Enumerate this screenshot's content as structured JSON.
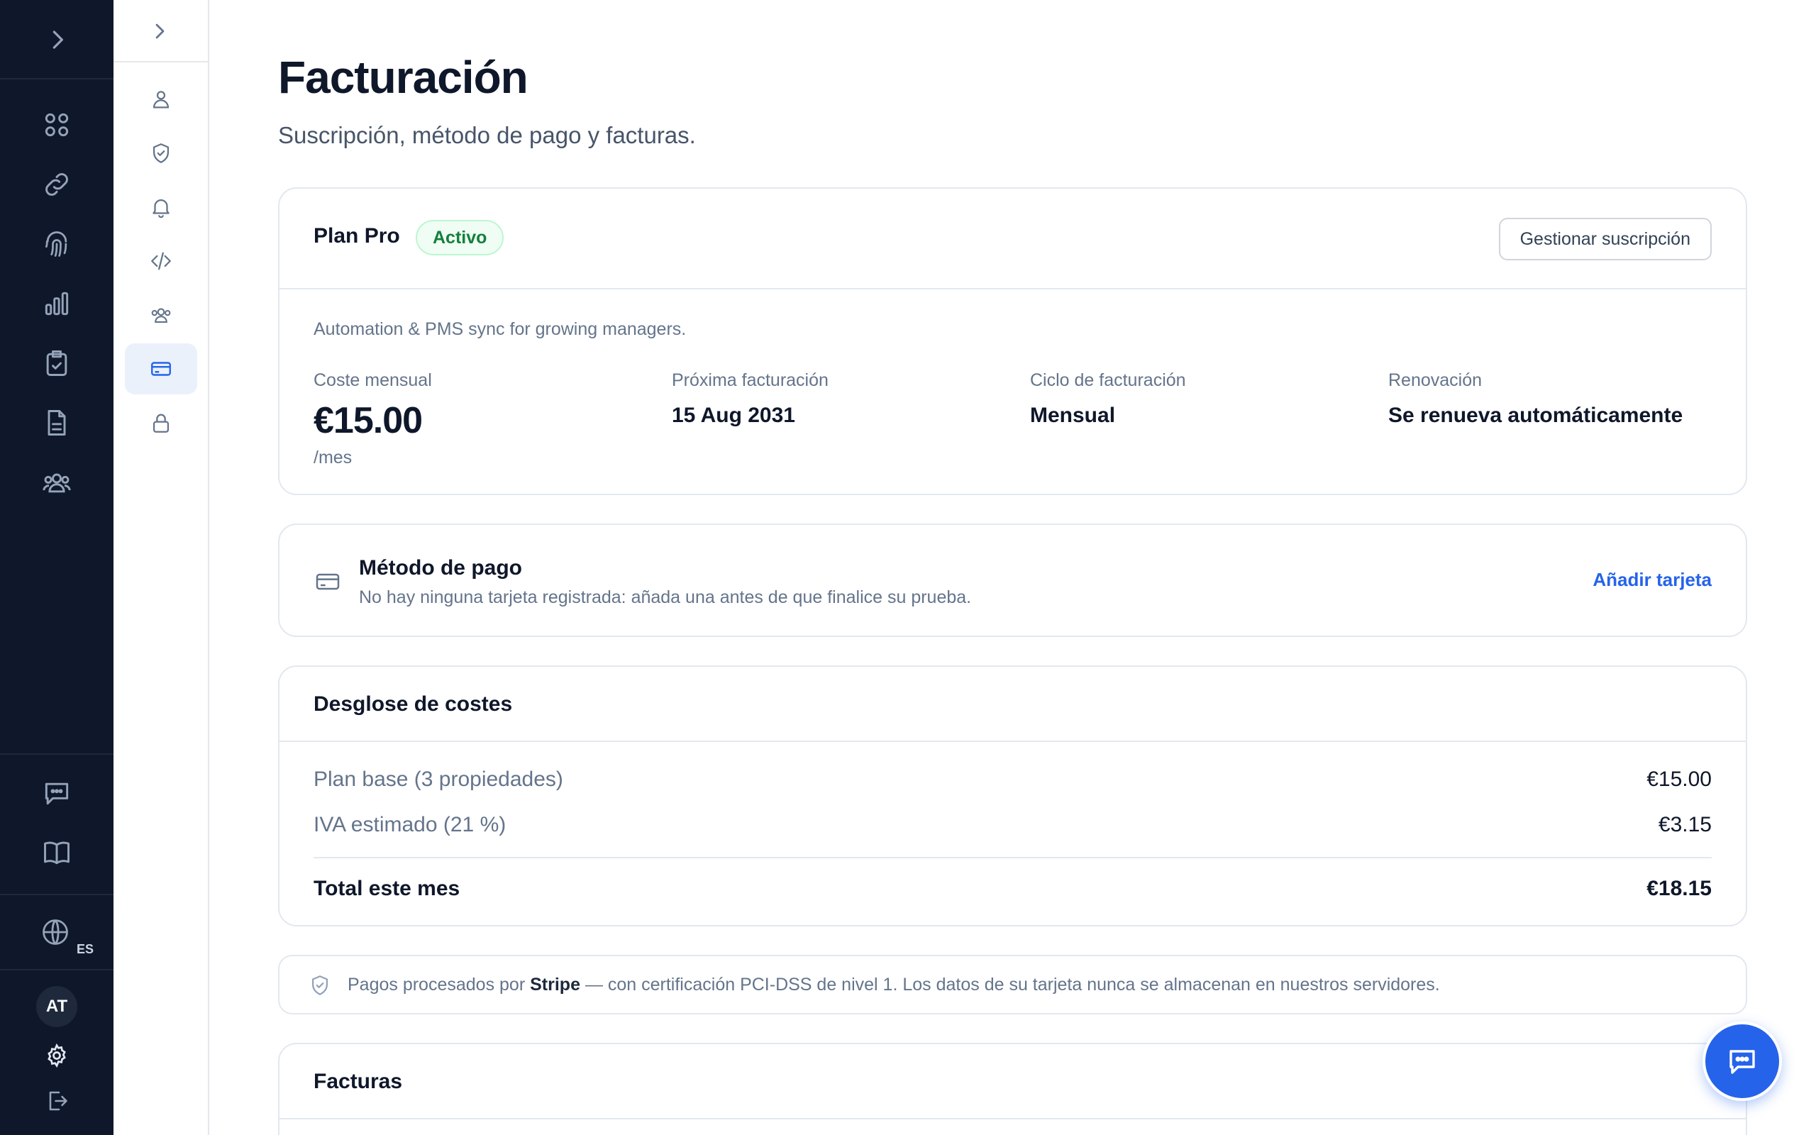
{
  "language": {
    "code": "ES"
  },
  "user": {
    "initials": "AT"
  },
  "page": {
    "title": "Facturación",
    "subtitle": "Suscripción, método de pago y facturas."
  },
  "plan": {
    "name": "Plan Pro",
    "status": "Activo",
    "manage_label": "Gestionar suscripción",
    "description": "Automation & PMS sync for growing managers.",
    "monthly_cost_label": "Coste mensual",
    "monthly_cost": "€15.00",
    "per_unit": "/mes",
    "next_billing_label": "Próxima facturación",
    "next_billing": "15 Aug 2031",
    "cycle_label": "Ciclo de facturación",
    "cycle": "Mensual",
    "renewal_label": "Renovación",
    "renewal": "Se renueva automáticamente"
  },
  "payment": {
    "title": "Método de pago",
    "subtitle": "No hay ninguna tarjeta registrada: añada una antes de que finalice su prueba.",
    "add_label": "Añadir tarjeta"
  },
  "costs": {
    "title": "Desglose de costes",
    "rows": [
      {
        "label": "Plan base (3 propiedades)",
        "value": "€15.00"
      },
      {
        "label": "IVA estimado (21 %)",
        "value": "€3.15"
      }
    ],
    "total": {
      "label": "Total este mes",
      "value": "€18.15"
    }
  },
  "security_note": {
    "prefix": "Pagos procesados por",
    "provider": "Stripe",
    "suffix": "— con certificación PCI-DSS de nivel 1. Los datos de su tarjeta nunca se almacenan en nuestros servidores."
  },
  "invoices": {
    "title": "Facturas"
  },
  "colors": {
    "rail_bg": "#0f172a",
    "accent": "#2563eb",
    "success": "#15803d"
  },
  "icons": {
    "rail": [
      "chevron-right-icon",
      "grid-icon",
      "link-icon",
      "fingerprint-icon",
      "bar-chart-icon",
      "clipboard-check-icon",
      "document-icon",
      "users-icon",
      "chat-icon",
      "book-icon",
      "globe-icon",
      "gear-icon",
      "logout-icon"
    ],
    "subnav": [
      "chevron-right-icon",
      "user-icon",
      "shield-check-icon",
      "bell-icon",
      "code-icon",
      "team-icon",
      "credit-card-icon",
      "lock-icon"
    ]
  }
}
